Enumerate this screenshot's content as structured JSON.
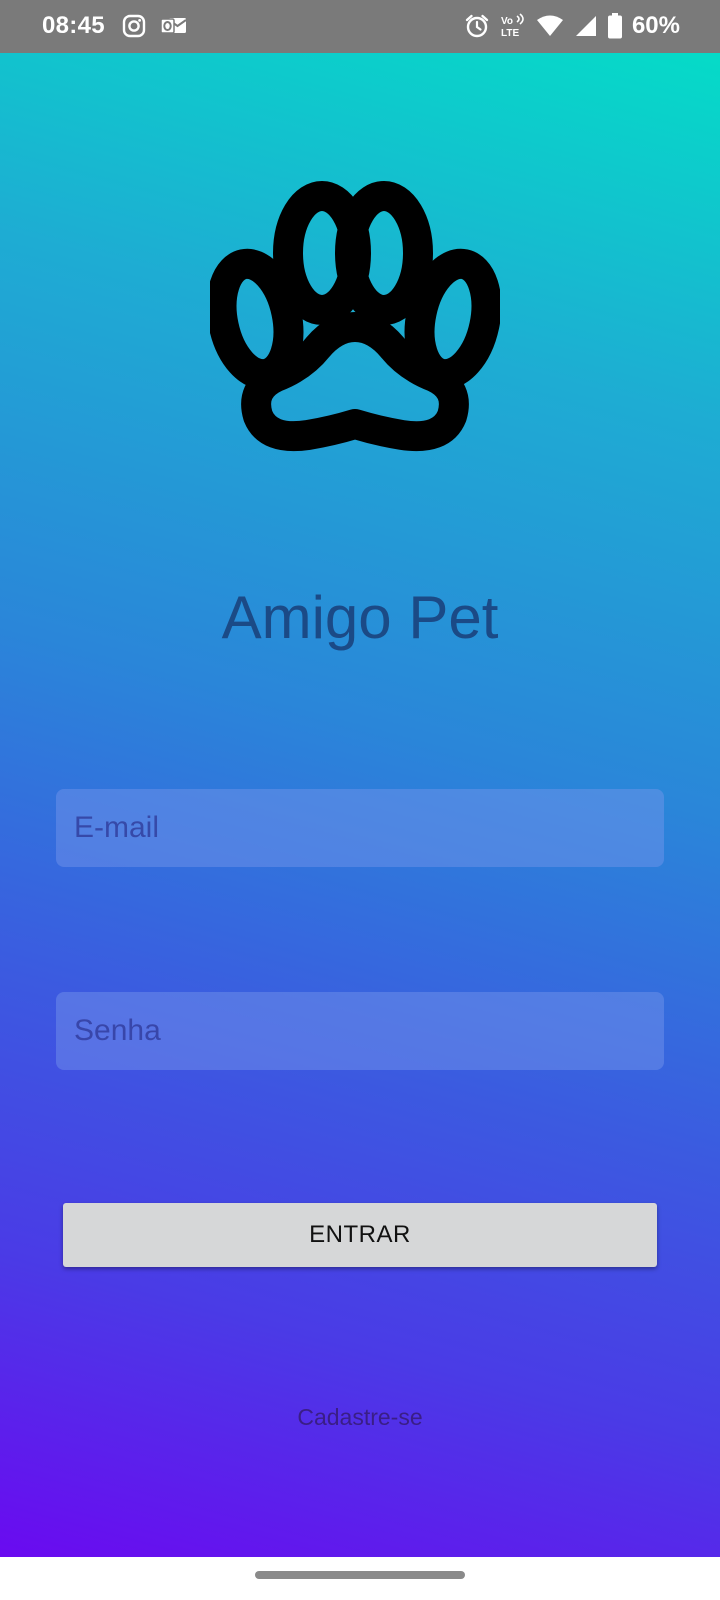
{
  "status_bar": {
    "time": "08:45",
    "left_icons": [
      "instagram-icon",
      "outlook-icon"
    ],
    "right_icons": [
      "alarm-icon",
      "volte-icon",
      "wifi-icon",
      "signal-icon",
      "battery-icon"
    ],
    "volte_text_top": "Vo",
    "volte_text_bottom": "LTE",
    "battery_percent": "60%"
  },
  "app": {
    "logo_icon": "paw-icon",
    "title": "Amigo Pet"
  },
  "form": {
    "email_placeholder": "E-mail",
    "email_value": "",
    "password_placeholder": "Senha",
    "password_value": "",
    "login_button_label": "ENTRAR",
    "signup_link_label": "Cadastre-se"
  },
  "colors": {
    "gradient_top": "#05dbc8",
    "gradient_bottom": "#6a0af0",
    "title_color": "#1b4a86",
    "button_bg": "#d6d7d8",
    "status_bar_bg": "#7a7a7a"
  }
}
